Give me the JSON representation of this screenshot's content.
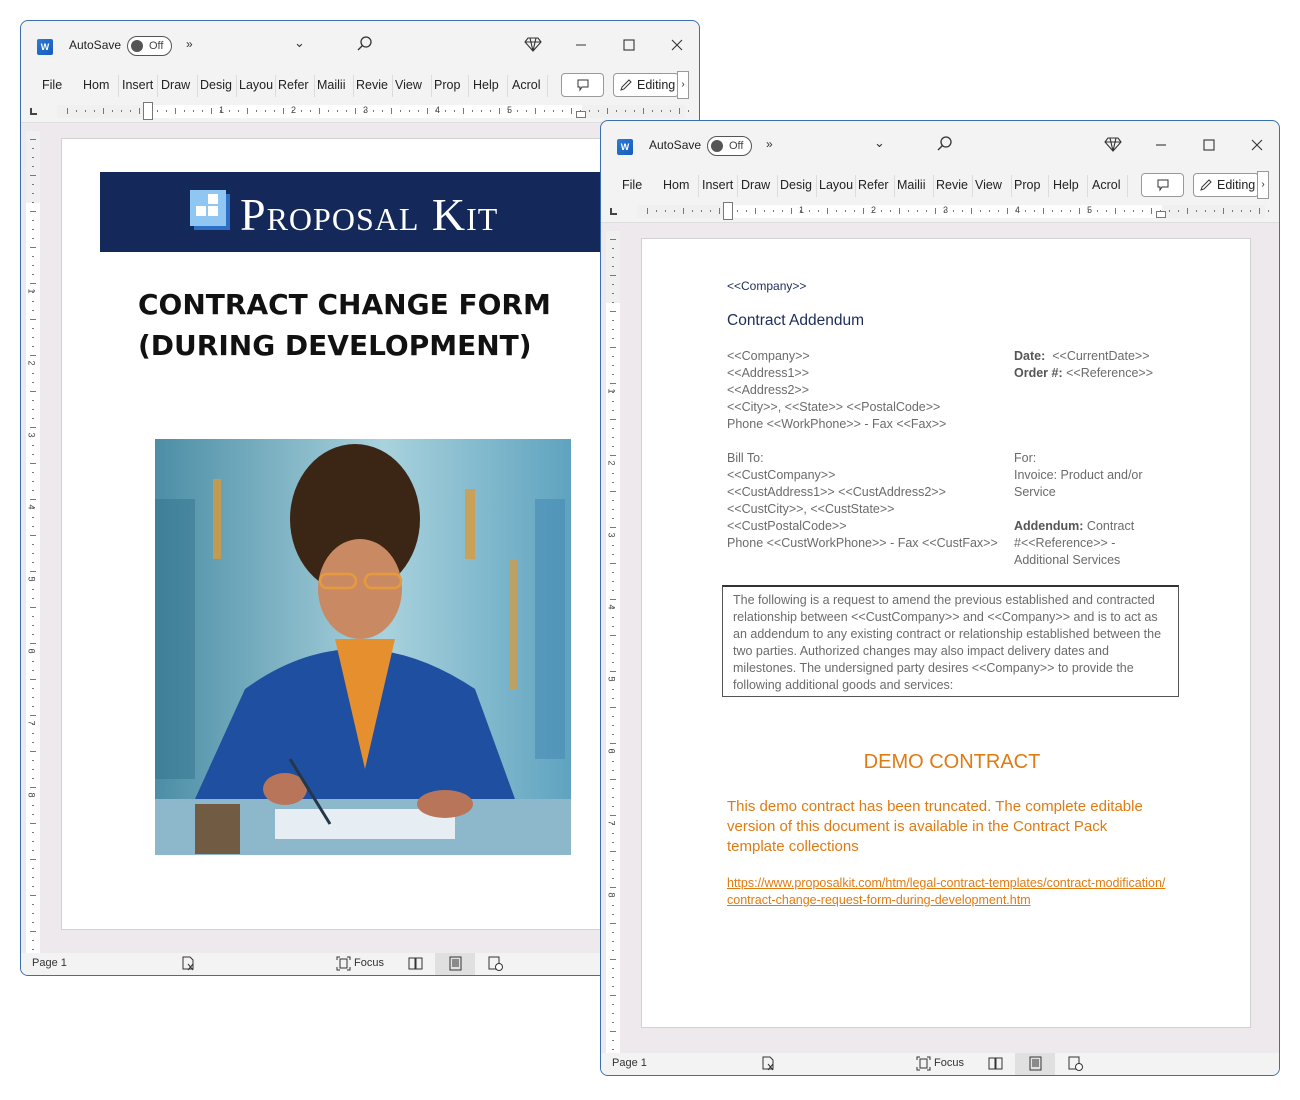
{
  "app": {
    "autosave_label": "AutoSave",
    "autosave_state": "Off",
    "more_commands": "»",
    "ribbon_tabs": [
      "File",
      "Home",
      "Insert",
      "Draw",
      "Design",
      "Layout",
      "References",
      "Mailings",
      "Review",
      "View",
      "Properties",
      "Help",
      "Acrobat"
    ],
    "ribbon_tabs_display": [
      "File",
      "Hom",
      "Insert",
      "Draw",
      "Desig",
      "Layou",
      "Refer",
      "Mailii",
      "Revie",
      "View",
      "Prop",
      "Help",
      "Acrol"
    ],
    "editing_label": "Editing",
    "ruler_numbers": [
      "1",
      "2",
      "3",
      "4",
      "5"
    ],
    "vruler_numbers": [
      "1",
      "2",
      "3",
      "4",
      "5",
      "6",
      "7",
      "8"
    ],
    "status": {
      "page": "Page 1",
      "focus_label": "Focus"
    }
  },
  "window1": {
    "logo_text": "Proposal Kit",
    "cover_title_line1": "CONTRACT CHANGE FORM",
    "cover_title_line2": "(DURING DEVELOPMENT)",
    "cover_image_alt": "Painted illustration of a woman in a blue jacket and glasses writing on documents at a desk"
  },
  "window2": {
    "company_header": "<<Company>>",
    "doc_title": "Contract Addendum",
    "sender": [
      "<<Company>>",
      "<<Address1>>",
      "<<Address2>>",
      "<<City>>, <<State>>  <<PostalCode>>",
      "Phone <<WorkPhone>>  - Fax <<Fax>>"
    ],
    "date_label": "Date:",
    "date_value": "<<CurrentDate>>",
    "order_label": "Order #:",
    "order_value": "<<Reference>>",
    "bill_to_label": "Bill To:",
    "bill_to": [
      "<<CustCompany>>",
      "<<CustAddress1>> <<CustAddress2>>",
      "<<CustCity>>, <<CustState>>",
      "<<CustPostalCode>>",
      "Phone <<CustWorkPhone>>  - Fax <<CustFax>>"
    ],
    "for_label": "For:",
    "for_lines": [
      "Invoice: Product and/or",
      "Service"
    ],
    "addendum_label": "Addendum:",
    "addendum_lines": [
      "Contract",
      "#<<Reference>> -",
      "Additional Services"
    ],
    "intro_text": "The following is a request to amend the previous established and contracted relationship between <<CustCompany>> and <<Company>> and is to act as an addendum to any existing contract or relationship established between the two parties. Authorized changes may also impact delivery dates and milestones.  The undersigned party desires <<Company>> to provide the following additional goods and services:",
    "demo_title": "DEMO CONTRACT",
    "demo_text": "This demo contract has been truncated. The complete editable version of this document is available in the Contract Pack template collections",
    "demo_link": "https://www.proposalkit.com/htm/legal-contract-templates/contract-modification/contract-change-request-form-during-development.htm"
  },
  "colors": {
    "banner": "#14295a",
    "accent_orange": "#e07b12",
    "doc_title": "#1d2d5a",
    "window_border": "#3a6fb0"
  }
}
